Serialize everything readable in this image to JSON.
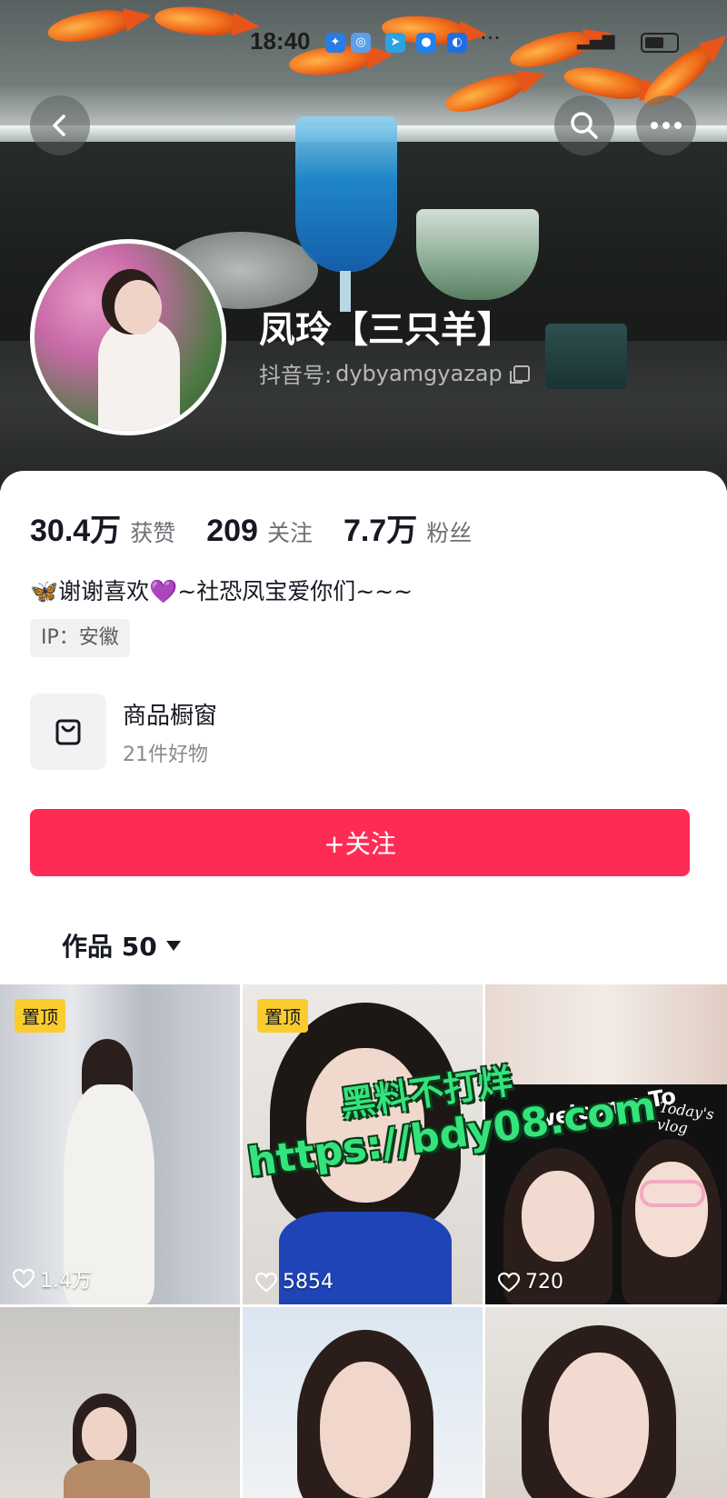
{
  "status_bar": {
    "time": "18:40",
    "overflow": "···"
  },
  "nav": {
    "back_icon": "back-arrow-icon",
    "search_icon": "search-icon",
    "more_icon": "more-dots-icon"
  },
  "profile": {
    "display_name": "凤玲【三只羊】",
    "douyin_id_label": "抖音号:",
    "douyin_id": "dybyamgyazap",
    "stats": [
      {
        "value": "30.4万",
        "label": "获赞"
      },
      {
        "value": "209",
        "label": "关注"
      },
      {
        "value": "7.7万",
        "label": "粉丝"
      }
    ],
    "bio": "🦋谢谢喜欢💜~社恐凤宝爱你们~~~",
    "ip": "IP：安徽"
  },
  "shop": {
    "title": "商品橱窗",
    "subtitle": "21件好物"
  },
  "follow_button": "+关注",
  "works_tab": {
    "label": "作品 50"
  },
  "videos": [
    {
      "pinned": true,
      "pin_label": "置顶",
      "likes": "1.4万"
    },
    {
      "pinned": true,
      "pin_label": "置顶",
      "likes": "5854"
    },
    {
      "pinned": false,
      "likes": "720"
    },
    {
      "pinned": false
    },
    {
      "pinned": false
    },
    {
      "pinned": false
    }
  ],
  "tile3_text": {
    "welcome": "welcome To",
    "todays_vlog": "Today's vlog"
  },
  "watermark": {
    "line1": "黑料不打烊",
    "line2": "https://bdy08.com"
  },
  "colors": {
    "accent": "#fe2c55",
    "pin_badge": "#facd2d",
    "text_primary": "#161823",
    "watermark": "#34e37c"
  }
}
